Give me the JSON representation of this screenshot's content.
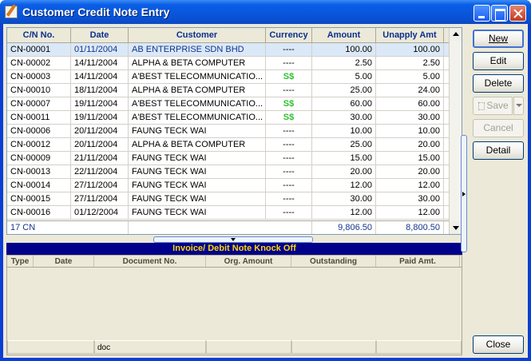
{
  "window": {
    "title": "Customer Credit Note Entry"
  },
  "grid": {
    "columns": [
      "C/N No.",
      "Date",
      "Customer",
      "Currency",
      "Amount",
      "Unapply Amt"
    ],
    "rows": [
      {
        "cn": "CN-00001",
        "date": "01/11/2004",
        "customer": "AB ENTERPRISE SDN BHD",
        "currency": "----",
        "amount": "100.00",
        "unapply": "100.00",
        "selected": true
      },
      {
        "cn": "CN-00002",
        "date": "14/11/2004",
        "customer": "ALPHA & BETA COMPUTER",
        "currency": "----",
        "amount": "2.50",
        "unapply": "2.50"
      },
      {
        "cn": "CN-00003",
        "date": "14/11/2004",
        "customer": "A'BEST TELECOMMUNICATIO...",
        "currency": "S$",
        "amount": "5.00",
        "unapply": "5.00"
      },
      {
        "cn": "CN-00010",
        "date": "18/11/2004",
        "customer": "ALPHA & BETA COMPUTER",
        "currency": "----",
        "amount": "25.00",
        "unapply": "24.00"
      },
      {
        "cn": "CN-00007",
        "date": "19/11/2004",
        "customer": "A'BEST TELECOMMUNICATIO...",
        "currency": "S$",
        "amount": "60.00",
        "unapply": "60.00"
      },
      {
        "cn": "CN-00011",
        "date": "19/11/2004",
        "customer": "A'BEST TELECOMMUNICATIO...",
        "currency": "S$",
        "amount": "30.00",
        "unapply": "30.00"
      },
      {
        "cn": "CN-00006",
        "date": "20/11/2004",
        "customer": "FAUNG TECK WAI",
        "currency": "----",
        "amount": "10.00",
        "unapply": "10.00"
      },
      {
        "cn": "CN-00012",
        "date": "20/11/2004",
        "customer": "ALPHA & BETA COMPUTER",
        "currency": "----",
        "amount": "25.00",
        "unapply": "20.00"
      },
      {
        "cn": "CN-00009",
        "date": "21/11/2004",
        "customer": "FAUNG TECK WAI",
        "currency": "----",
        "amount": "15.00",
        "unapply": "15.00"
      },
      {
        "cn": "CN-00013",
        "date": "22/11/2004",
        "customer": "FAUNG TECK WAI",
        "currency": "----",
        "amount": "20.00",
        "unapply": "20.00"
      },
      {
        "cn": "CN-00014",
        "date": "27/11/2004",
        "customer": "FAUNG TECK WAI",
        "currency": "----",
        "amount": "12.00",
        "unapply": "12.00"
      },
      {
        "cn": "CN-00015",
        "date": "27/11/2004",
        "customer": "FAUNG TECK WAI",
        "currency": "----",
        "amount": "30.00",
        "unapply": "30.00"
      },
      {
        "cn": "CN-00016",
        "date": "01/12/2004",
        "customer": "FAUNG TECK WAI",
        "currency": "----",
        "amount": "12.00",
        "unapply": "12.00"
      }
    ],
    "footer": {
      "count": "17 CN",
      "amount_total": "9,806.50",
      "unapply_total": "8,800.50"
    }
  },
  "knock_off": {
    "title": "Invoice/ Debit Note Knock Off",
    "columns": [
      "Type",
      "Date",
      "Document No.",
      "Org. Amount",
      "Outstanding",
      "Paid Amt."
    ],
    "footer_cells": [
      "",
      "doc",
      "",
      "",
      "",
      ""
    ]
  },
  "buttons": {
    "new": "New",
    "edit": "Edit",
    "delete": "Delete",
    "save": "Save",
    "cancel": "Cancel",
    "detail": "Detail",
    "close": "Close"
  },
  "colors": {
    "title_bar": "#0853d8",
    "knock_title_bg": "#00008b",
    "knock_title_fg": "#ffd700",
    "currency_sgd": "#2cc12c"
  }
}
